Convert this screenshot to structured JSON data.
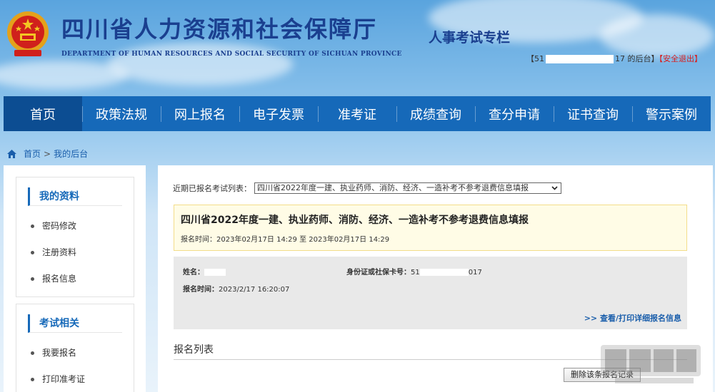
{
  "header": {
    "title": "四川省人力资源和社会保障厅",
    "subtitle": "DEPARTMENT OF HUMAN RESOURCES AND SOCIAL SECURITY OF SICHUAN PROVINCE",
    "section": "人事考试专栏",
    "user_prefix": "【51",
    "user_suffix": "17 的后台】",
    "logout": "【安全退出】"
  },
  "nav": {
    "items": [
      "首页",
      "政策法规",
      "网上报名",
      "电子发票",
      "准考证",
      "成绩查询",
      "查分申请",
      "证书查询",
      "警示案例"
    ]
  },
  "breadcrumb": {
    "home": "首页",
    "sep": ">",
    "current": "我的后台"
  },
  "sidebar": {
    "section1": {
      "title": "我的资料",
      "items": [
        "密码修改",
        "注册资料",
        "报名信息"
      ]
    },
    "section2": {
      "title": "考试相关",
      "items": [
        "我要报名",
        "打印准考证"
      ]
    }
  },
  "main": {
    "recent_label": "近期已报名考试列表：",
    "recent_selected": "四川省2022年度一建、执业药师、消防、经济、一造补考不参考退费信息填报",
    "notice_title": "四川省2022年度一建、执业药师、消防、经济、一造补考不参考退费信息填报",
    "notice_time_label": "报名时间：",
    "notice_time_value": "2023年02月17日 14:29 至 2023年02月17日 14:29",
    "name_label": "姓名：",
    "id_label": "身份证或社保卡号：",
    "id_prefix": "51",
    "id_suffix": "017",
    "reg_time_label": "报名时间：",
    "reg_time_value": "2023/2/17 16:20:07",
    "detail_link": ">> 查看/打印详细报名信息",
    "list_title": "报名列表",
    "delete_button": "删除该条报名记录"
  },
  "colors": {
    "nav_bg": "#1669b9",
    "nav_active": "#0c4d92",
    "title_blue": "#1a3f8f",
    "logout_red": "#d81e1e"
  }
}
